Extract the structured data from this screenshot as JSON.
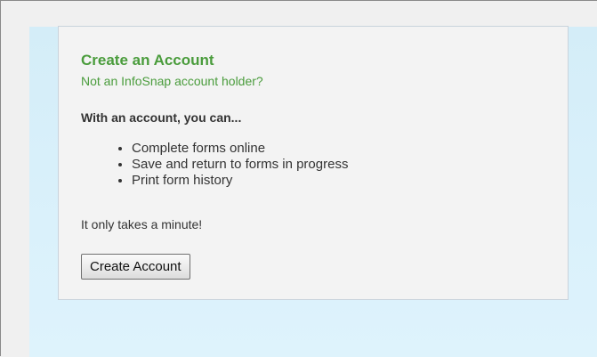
{
  "panel": {
    "title": "Create an Account",
    "subtitle": "Not an InfoSnap account holder?",
    "lead": "With an account, you can...",
    "benefits": [
      "Complete forms online",
      "Save and return to forms in progress",
      "Print form history"
    ],
    "note": "It only takes a minute!",
    "button_label": "Create Account"
  },
  "colors": {
    "title": "#4a9c3c",
    "page_background": "#f0f0f0",
    "content_background": "#d4edf8",
    "panel_background": "#f3f3f3"
  }
}
